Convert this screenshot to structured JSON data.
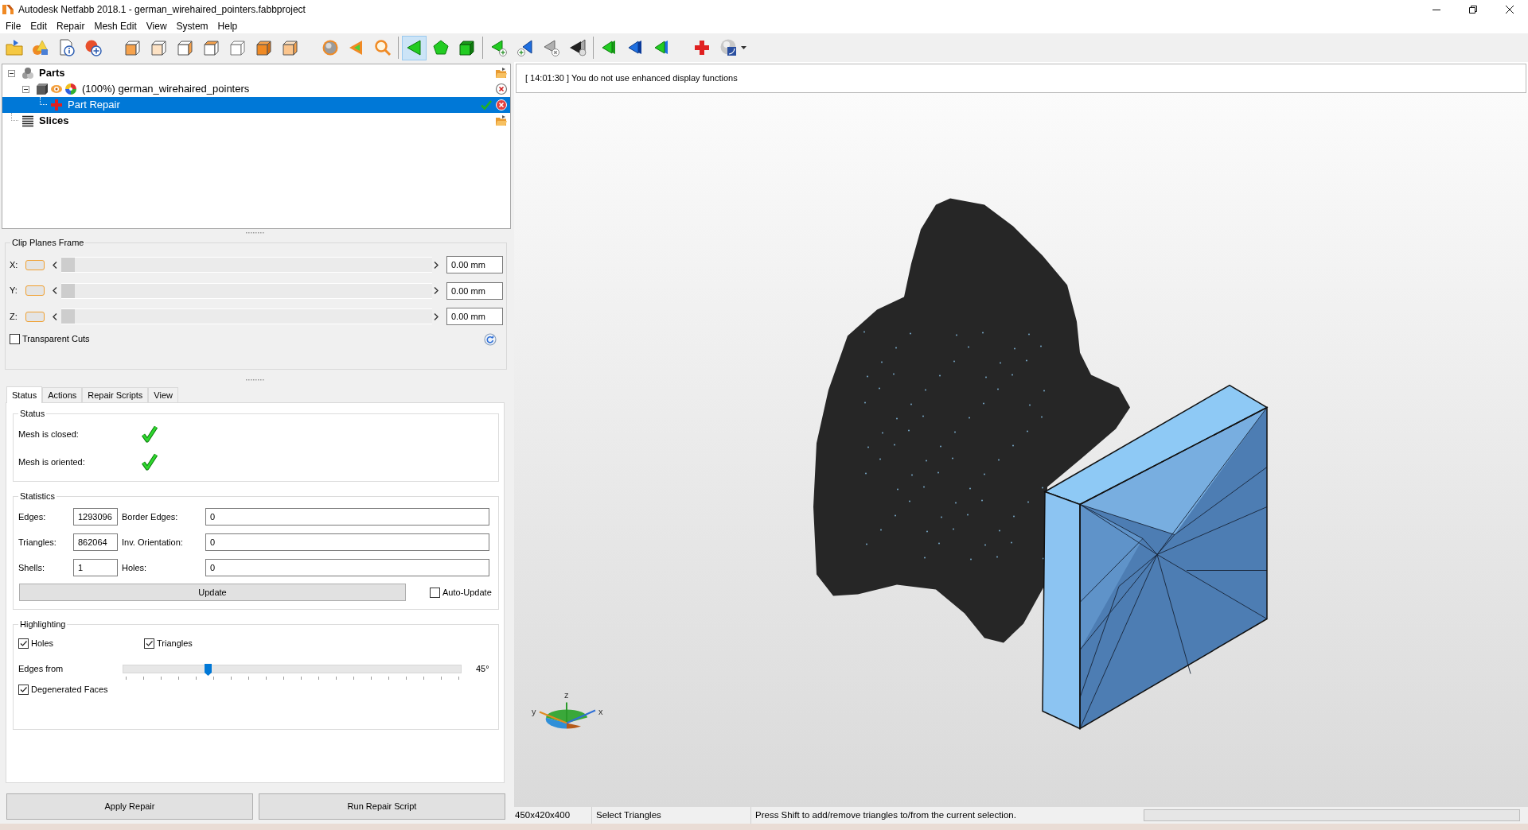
{
  "window": {
    "title": "Autodesk Netfabb 2018.1 - german_wirehaired_pointers.fabbproject"
  },
  "menu": [
    "File",
    "Edit",
    "Repair",
    "Mesh Edit",
    "View",
    "System",
    "Help"
  ],
  "toolbar": {
    "groups": [
      {
        "kind": "buttons",
        "items": [
          {
            "kind": "open",
            "selected": false
          },
          {
            "kind": "shapes",
            "selected": false
          },
          {
            "kind": "info",
            "selected": false
          },
          {
            "kind": "add_part",
            "selected": false
          }
        ]
      },
      {
        "kind": "buttons",
        "items": [
          {
            "kind": "view_left",
            "selected": false
          },
          {
            "kind": "view_bottom",
            "selected": false
          },
          {
            "kind": "view_right",
            "selected": false
          },
          {
            "kind": "view_back",
            "selected": false
          },
          {
            "kind": "view_outline",
            "selected": false
          },
          {
            "kind": "view_solid",
            "selected": false
          },
          {
            "kind": "view_light",
            "selected": false
          }
        ]
      },
      {
        "kind": "buttons",
        "items": [
          {
            "kind": "sphere",
            "selected": false
          },
          {
            "kind": "cone",
            "selected": false
          },
          {
            "kind": "search",
            "selected": false
          }
        ]
      },
      {
        "kind": "separator"
      },
      {
        "kind": "buttons",
        "items": [
          {
            "kind": "triangle",
            "selected": true
          },
          {
            "kind": "pentagon",
            "selected": false
          },
          {
            "kind": "cube",
            "selected": false
          }
        ]
      },
      {
        "kind": "separator"
      },
      {
        "kind": "buttons",
        "items": [
          {
            "kind": "triangle_add",
            "selected": false
          },
          {
            "kind": "triangle_add_blue",
            "selected": false
          },
          {
            "kind": "triangle_remove",
            "selected": false
          },
          {
            "kind": "triangle_dark",
            "selected": false
          }
        ]
      },
      {
        "kind": "separator"
      },
      {
        "kind": "buttons",
        "items": [
          {
            "kind": "triangles_green",
            "selected": false
          },
          {
            "kind": "triangles_blue",
            "selected": false
          },
          {
            "kind": "triangles_mixed",
            "selected": false
          }
        ]
      },
      {
        "kind": "buttons",
        "items": [
          {
            "kind": "repair",
            "selected": false
          },
          {
            "kind": "render",
            "selected": false
          }
        ]
      }
    ]
  },
  "tree": [
    {
      "kind": "parts",
      "label": "Parts",
      "expanded": true,
      "selected": false,
      "children": [
        {
          "kind": "part",
          "label": "(100%) german_wirehaired_pointers",
          "expanded": true,
          "selected": false,
          "children": [
            {
              "kind": "repair",
              "label": "Part Repair",
              "selected": true
            }
          ]
        }
      ]
    },
    {
      "kind": "slices",
      "label": "Slices",
      "selected": false
    }
  ],
  "clip_planes": {
    "title": "Clip Planes Frame",
    "axes": [
      {
        "label": "X:",
        "on": false,
        "level": 0,
        "value": "0.00 mm"
      },
      {
        "label": "Y:",
        "on": false,
        "level": 0,
        "value": "0.00 mm"
      },
      {
        "label": "Z:",
        "on": false,
        "level": 0,
        "value": "0.00 mm"
      }
    ],
    "transparent_cuts": {
      "label": "Transparent Cuts",
      "checked": false
    }
  },
  "tabs": [
    {
      "label": "Status",
      "selected": true
    },
    {
      "label": "Actions",
      "selected": false
    },
    {
      "label": "Repair Scripts",
      "selected": false
    },
    {
      "label": "View",
      "selected": false
    }
  ],
  "mesh_status": {
    "title": "Status",
    "checks": [
      {
        "label": "Mesh is closed:",
        "ok": true
      },
      {
        "label": "Mesh is oriented:",
        "ok": true
      }
    ]
  },
  "statistics": {
    "title": "Statistics",
    "rows": [
      {
        "fields": [
          {
            "label": "Edges:",
            "value": "1293096"
          },
          {
            "label": "Border Edges:",
            "value": "0"
          }
        ]
      },
      {
        "fields": [
          {
            "label": "Triangles:",
            "value": "862064"
          },
          {
            "label": "Inv. Orientation:",
            "value": "0"
          }
        ]
      },
      {
        "fields": [
          {
            "label": "Shells:",
            "value": "1"
          },
          {
            "label": "Holes:",
            "value": "0"
          }
        ]
      }
    ],
    "update_button": "Update",
    "auto_update": {
      "label": "Auto-Update",
      "checked": false
    }
  },
  "highlighting": {
    "title": "Highlighting",
    "options": [
      {
        "label": "Holes",
        "checked": true
      },
      {
        "label": "Triangles",
        "checked": true
      }
    ],
    "edges_from": {
      "label": "Edges from",
      "level": 0.25,
      "reading": "45°"
    },
    "degenerated_faces": {
      "label": "Degenerated Faces",
      "checked": true
    }
  },
  "buttons": [
    "Apply Repair",
    "Run Repair Script"
  ],
  "log": {
    "entries": [
      "[ 14:01:30 ] You do not use enhanced display functions"
    ]
  },
  "viewport": {
    "axis_gizmo": {
      "z_label": "z",
      "y_label": "y",
      "x_label": "x"
    }
  },
  "status_bar": {
    "dimensions": "450x420x400",
    "mode": "Select Triangles",
    "hint": "Press Shift to add/remove triangles to/from the current selection.",
    "progress": {
      "level": 0
    }
  }
}
